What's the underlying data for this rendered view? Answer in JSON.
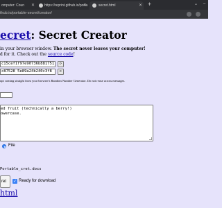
{
  "browser": {
    "tabs": [
      {
        "label": "omputer: Coun"
      },
      {
        "label": "https://reprint.github.io/porta"
      },
      {
        "label": "secret.html"
      }
    ],
    "new_tab_label": "+",
    "url": "thub.io/portable-secret/creator/"
  },
  "page": {
    "title_link": "ecret",
    "title_rest": ": Secret Creator",
    "intro_line1_start": " in your browser window. ",
    "intro_line1_bold": "The secret never leaves your computer!",
    "intro_line2_start": "d for it. Check out the ",
    "intro_line2_link": "source code",
    "intro_line2_end": "!",
    "salt_value": "c15cef1f97e90736b881751",
    "iv_value": "c87528 5e89a24b240c3f8",
    "random_note": "upt coming straight from your browser's Random Number Generator. Do not reuse across messages.",
    "message_line1": "ed fruit (technically a berry!)",
    "message_line2": "owercase.",
    "radio_file_label": "File",
    "output_filename": "Portable_cret.docs",
    "generate_label": "ret",
    "ready_label": "Ready for download",
    "bottom_link": "html"
  }
}
